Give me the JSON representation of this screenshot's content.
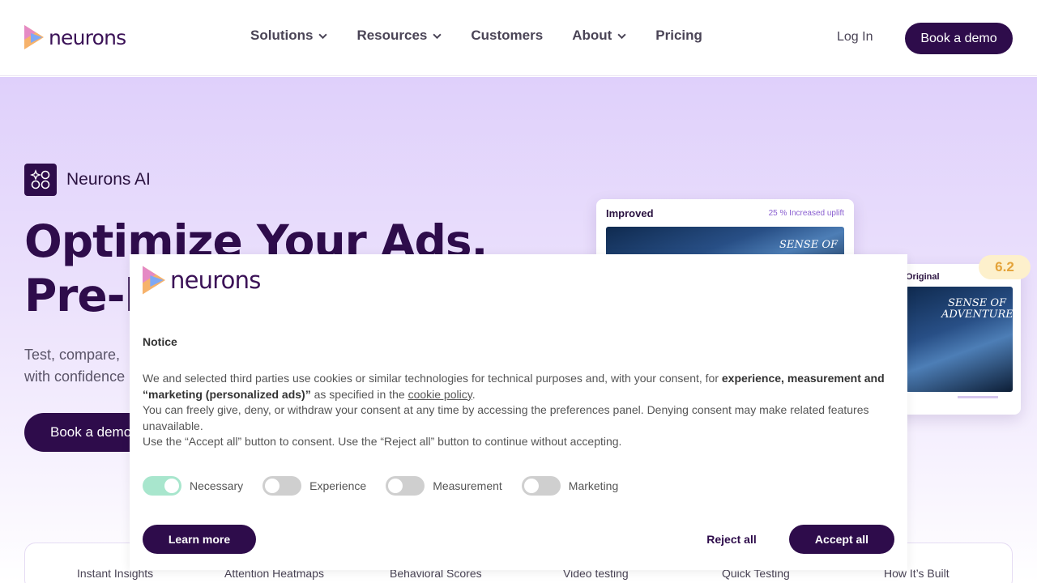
{
  "header": {
    "logo_text": "neurons",
    "nav": [
      {
        "label": "Solutions",
        "has_dropdown": true
      },
      {
        "label": "Resources",
        "has_dropdown": true
      },
      {
        "label": "Customers",
        "has_dropdown": false
      },
      {
        "label": "About",
        "has_dropdown": true
      },
      {
        "label": "Pricing",
        "has_dropdown": false
      }
    ],
    "login_label": "Log In",
    "cta_label": "Book a demo"
  },
  "hero": {
    "badge_label": "Neurons AI",
    "title_line1": "Optimize Your Ads.",
    "title_line2": "Pre-l",
    "subtitle_line1": "Test, compare,",
    "subtitle_line2": "with confidence",
    "cta_label": "Book a demo",
    "card_improved": {
      "title": "Improved",
      "uplift": "25 % Increased uplift",
      "image_text": "SENSE OF"
    },
    "card_original": {
      "title": "Original",
      "image_text": "SENSE OF ADVENTURE"
    },
    "score": "6.2"
  },
  "tabs": [
    "Instant Insights",
    "Attention Heatmaps",
    "Behavioral Scores",
    "Video testing",
    "Quick Testing",
    "How It’s Built"
  ],
  "cookie": {
    "logo_text": "neurons",
    "notice_title": "Notice",
    "text_part1": "We and selected third parties use cookies or similar technologies for technical purposes and, with your consent, for ",
    "text_bold": "experience, measurement and “marketing (personalized ads)”",
    "text_part2": " as specified in the ",
    "policy_link": "cookie policy",
    "text_part3": ".",
    "line2": "You can freely give, deny, or withdraw your consent at any time by accessing the preferences panel. Denying consent may make related features unavailable.",
    "line3": "Use the “Accept all” button to consent. Use the “Reject all” button to continue without accepting.",
    "toggles": [
      {
        "label": "Necessary",
        "on": true
      },
      {
        "label": "Experience",
        "on": false
      },
      {
        "label": "Measurement",
        "on": false
      },
      {
        "label": "Marketing",
        "on": false
      }
    ],
    "learn_more": "Learn more",
    "reject_all": "Reject all",
    "accept_all": "Accept all"
  },
  "colors": {
    "brand": "#2e0c4b",
    "hero_bg": "#dfd0fb",
    "toggle_on": "#a8e6cd",
    "score": "#e4a33a"
  }
}
